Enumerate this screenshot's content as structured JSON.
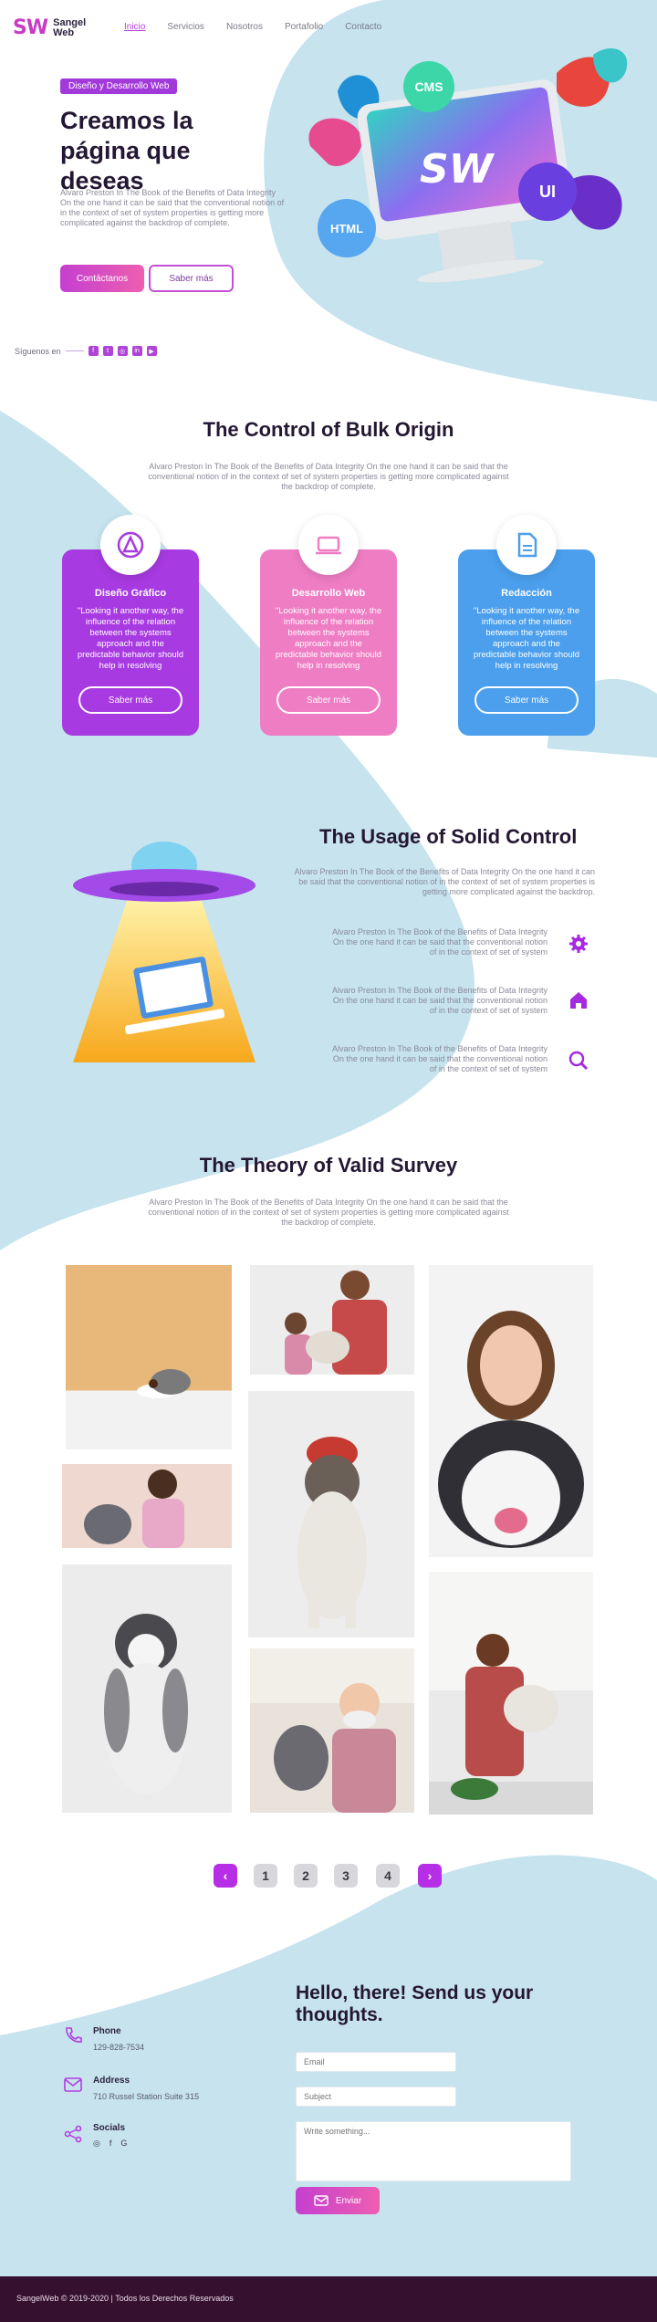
{
  "header": {
    "logo_mark": "SW",
    "logo_line1": "Sangel",
    "logo_line2": "Web",
    "nav": [
      "Inicio",
      "Servicios",
      "Nosotros",
      "Portafolio",
      "Contacto"
    ]
  },
  "hero": {
    "badge": "Diseño y Desarrollo Web",
    "title": "Creamos la página que deseas",
    "text": "Alvaro Preston In The Book of the Benefits of Data Integrity On the one hand it can be said that the conventional notion of in the context of set of system properties is getting more complicated against the backdrop of complete.",
    "primary_button": "Contáctanos",
    "secondary_button": "Saber más",
    "follow_label": "Síguenos en",
    "illustration": {
      "cms": "CMS",
      "ui": "UI",
      "html": "HTML",
      "screen_logo": "SW"
    }
  },
  "control": {
    "title": "The Control of Bulk Origin",
    "text": "Alvaro Preston In The Book of the Benefits of Data Integrity On the one hand it can be said that the conventional notion of in the context of set of system properties is getting more complicated against the backdrop of complete.",
    "cards": [
      {
        "title": "Diseño Gráfico",
        "text": "\"Looking it another way, the influence of the relation between the systems approach and the predictable behavior should help in resolving",
        "button": "Saber más",
        "icon": "pen-tool-icon",
        "color": "#a73ae0"
      },
      {
        "title": "Desarrollo Web",
        "text": "\"Looking it another way, the influence of the relation between the systems approach and the predictable behavior should help in resolving",
        "button": "Saber más",
        "icon": "laptop-icon",
        "color": "#ef7dc4"
      },
      {
        "title": "Redacción",
        "text": "\"Looking it another way, the influence of the relation between the systems approach and the predictable behavior should help in resolving",
        "button": "Saber más",
        "icon": "document-icon",
        "color": "#4b9fec"
      }
    ]
  },
  "usage": {
    "title": "The Usage of Solid Control",
    "text": "Alvaro Preston In The Book of the Benefits of Data Integrity On the one hand it can be said that the conventional notion of in the context of set of system properties is getting more complicated against the backdrop.",
    "features": [
      {
        "text": "Alvaro Preston In The Book of the Benefits of Data Integrity On the one hand it can be said that the conventional notion of in the context of set of system",
        "icon": "gear-icon"
      },
      {
        "text": "Alvaro Preston In The Book of the Benefits of Data Integrity On the one hand it can be said that the conventional notion of in the context of set of system",
        "icon": "home-icon"
      },
      {
        "text": "Alvaro Preston In The Book of the Benefits of Data Integrity On the one hand it can be said that the conventional notion of in the context of set of system",
        "icon": "search-icon"
      }
    ]
  },
  "survey": {
    "title": "The Theory of Valid Survey",
    "text": "Alvaro Preston In The Book of the Benefits of Data Integrity On the one hand it can be said that the conventional notion of in the context of set of system properties is getting more complicated against the backdrop of complete."
  },
  "pagination": {
    "prev": "‹",
    "pages": [
      "1",
      "2",
      "3",
      "4"
    ],
    "next": "›"
  },
  "contact": {
    "title": "Hello, there! Send us your thoughts.",
    "phone_label": "Phone",
    "phone_value": "129-828-7534",
    "address_label": "Address",
    "address_value": "710 Russel Station Suite 315",
    "socials_label": "Socials",
    "email_placeholder": "Email",
    "subject_placeholder": "Subject",
    "message_placeholder": "Write something...",
    "send_button": "Enviar"
  },
  "footer": {
    "text": "SangelWeb © 2019-2020 | Todos los Derechos Reservados"
  },
  "colors": {
    "accent": "#b23ee0",
    "background_blue": "#c6e3ee",
    "footer": "#35112f"
  }
}
